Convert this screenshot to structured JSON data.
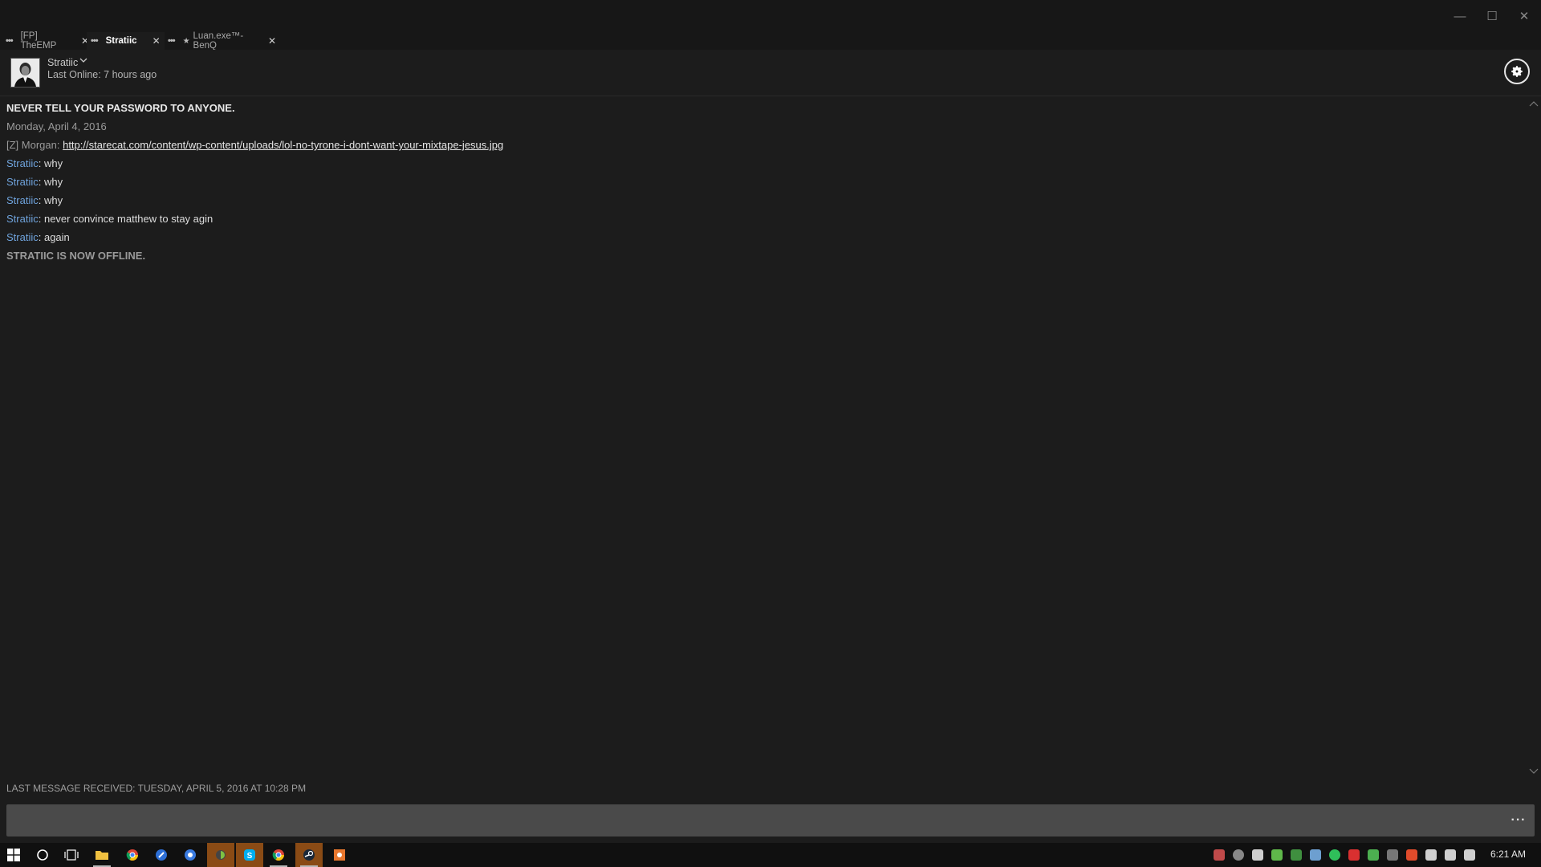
{
  "window": {
    "minimize_glyph": "—",
    "maximize_glyph": "☐",
    "close_glyph": "✕"
  },
  "tabs": [
    {
      "label": "[FP] TheEMP",
      "active": false
    },
    {
      "label": "Stratiic",
      "active": true
    },
    {
      "label": "Luan.exe™-BenQ",
      "active": false,
      "starred": true
    }
  ],
  "header": {
    "friend_name": "Stratiic",
    "last_online": "Last Online: 7 hours ago"
  },
  "chat": {
    "warning": "NEVER TELL YOUR PASSWORD TO ANYONE.",
    "date": "Monday, April 4, 2016",
    "messages": [
      {
        "sender": "[Z] Morgan",
        "text": "http://starecat.com/content/wp-content/uploads/lol-no-tyrone-i-dont-want-your-mixtape-jesus.jpg",
        "is_link": true,
        "self": false
      },
      {
        "sender": "Stratiic",
        "text": "why",
        "is_link": false,
        "self": true
      },
      {
        "sender": "Stratiic",
        "text": "why",
        "is_link": false,
        "self": true
      },
      {
        "sender": "Stratiic",
        "text": "why",
        "is_link": false,
        "self": true
      },
      {
        "sender": "Stratiic",
        "text": "never convince matthew to stay agin",
        "is_link": false,
        "self": true
      },
      {
        "sender": "Stratiic",
        "text": "again",
        "is_link": false,
        "self": true
      }
    ],
    "status": "STRATIIC IS NOW OFFLINE.",
    "separator": ": "
  },
  "footer": {
    "last_message": "LAST MESSAGE RECEIVED: TUESDAY, APRIL 5, 2016 AT 10:28 PM",
    "input_value": "",
    "more_label": "···"
  },
  "taskbar": {
    "clock": "6:21 AM"
  },
  "colors": {
    "background": "#1c1c1c",
    "self_sender": "#6fa3dc",
    "input_bg": "#4a4a4a",
    "taskbar_bg": "#101010",
    "active_app": "#8a4b15"
  }
}
